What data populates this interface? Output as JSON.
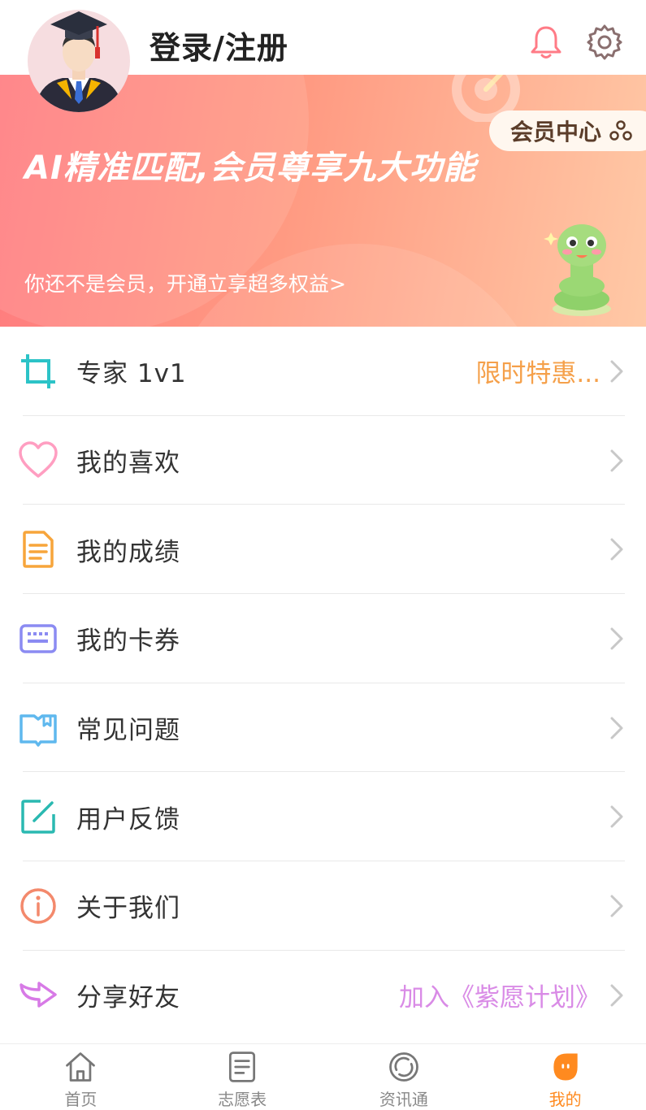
{
  "header": {
    "login_label": "登录/注册"
  },
  "banner": {
    "headline": "AI精准匹配,会员尊享九大功能",
    "subtitle": "你还不是会员，开通立享超多权益>",
    "member_center_label": "会员中心"
  },
  "menu": {
    "items": [
      {
        "label": "专家 1v1",
        "extra": "限时特惠...",
        "extra_color": "#f5a04a",
        "icon": "crop-icon"
      },
      {
        "label": "我的喜欢",
        "extra": "",
        "icon": "heart-icon"
      },
      {
        "label": "我的成绩",
        "extra": "",
        "icon": "document-icon"
      },
      {
        "label": "我的卡券",
        "extra": "",
        "icon": "keyboard-icon"
      },
      {
        "label": "常见问题",
        "extra": "",
        "icon": "book-icon"
      },
      {
        "label": "用户反馈",
        "extra": "",
        "icon": "edit-icon"
      },
      {
        "label": "关于我们",
        "extra": "",
        "icon": "info-icon"
      },
      {
        "label": "分享好友",
        "extra": "加入《紫愿计划》",
        "extra_color": "#d98be6",
        "icon": "share-icon"
      }
    ]
  },
  "tabbar": {
    "tabs": [
      {
        "label": "首页",
        "icon": "home-icon",
        "active": false
      },
      {
        "label": "志愿表",
        "icon": "list-icon",
        "active": false
      },
      {
        "label": "资讯通",
        "icon": "circle-icon",
        "active": false
      },
      {
        "label": "我的",
        "icon": "profile-icon",
        "active": true
      }
    ]
  },
  "colors": {
    "accent_orange": "#ff8a1f",
    "banner_start": "#ff7a7e",
    "banner_end": "#ffc9a6"
  }
}
